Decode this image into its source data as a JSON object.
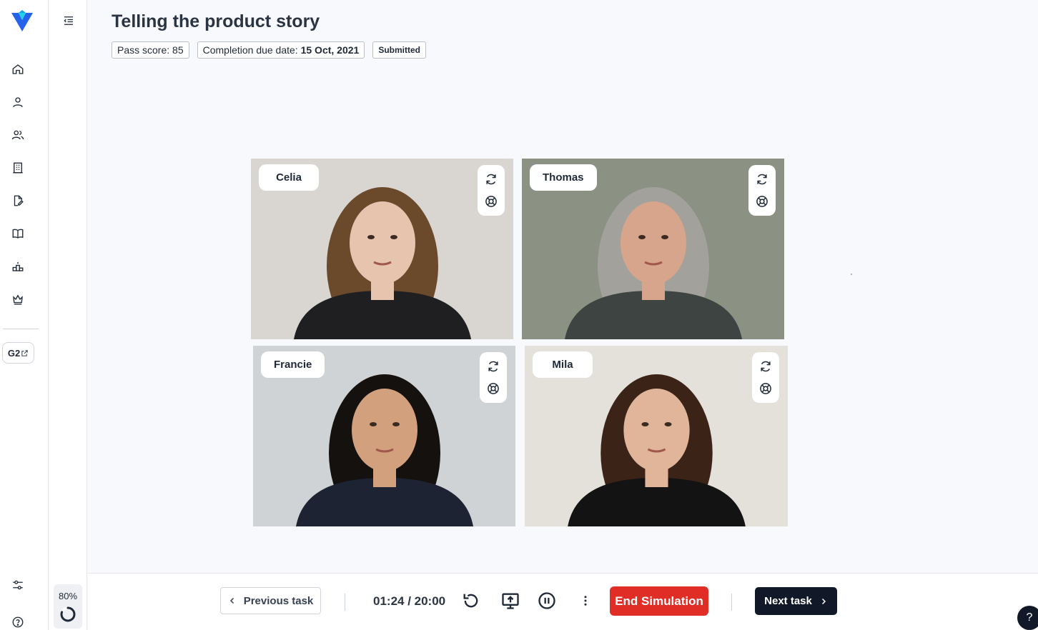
{
  "header": {
    "title": "Telling the product story",
    "pass_score_label": "Pass score: 85",
    "due_date_label": "Completion due date: ",
    "due_date_value": "15 Oct, 2021",
    "status": "Submitted"
  },
  "sidebar": {
    "items": [
      {
        "icon": "home-icon"
      },
      {
        "icon": "user-icon"
      },
      {
        "icon": "users-icon"
      },
      {
        "icon": "building-icon"
      },
      {
        "icon": "file-edit-icon"
      },
      {
        "icon": "book-icon"
      },
      {
        "icon": "podium-icon"
      },
      {
        "icon": "crown-icon"
      }
    ],
    "g2_label": "G2",
    "settings_icon": "sliders-icon",
    "help_icon": "help-circle-icon"
  },
  "progress": {
    "label": "80%",
    "value": 0.8
  },
  "participants": [
    {
      "name": "Celia",
      "bg": "#d9d6d1",
      "hair": "#6b4a2c",
      "skin": "#e6c4ad",
      "shirt": "#1f1f22"
    },
    {
      "name": "Thomas",
      "bg": "#8b9183",
      "hair": "#a3a19c",
      "skin": "#d6a58b",
      "shirt": "#3e4442"
    },
    {
      "name": "Francie",
      "bg": "#cfd3d6",
      "hair": "#14110f",
      "skin": "#d3a07e",
      "shirt": "#1d2333"
    },
    {
      "name": "Mila",
      "bg": "#e4e1da",
      "hair": "#3b2417",
      "skin": "#e1b59a",
      "shirt": "#131313"
    }
  ],
  "tile_controls": {
    "refresh_icon": "refresh-icon",
    "lifebuoy_icon": "lifebuoy-icon"
  },
  "bottom_bar": {
    "prev_label": "Previous task",
    "timer": "01:24 / 20:00",
    "end_label": "End Simulation",
    "next_label": "Next task"
  },
  "help_fab": "?"
}
